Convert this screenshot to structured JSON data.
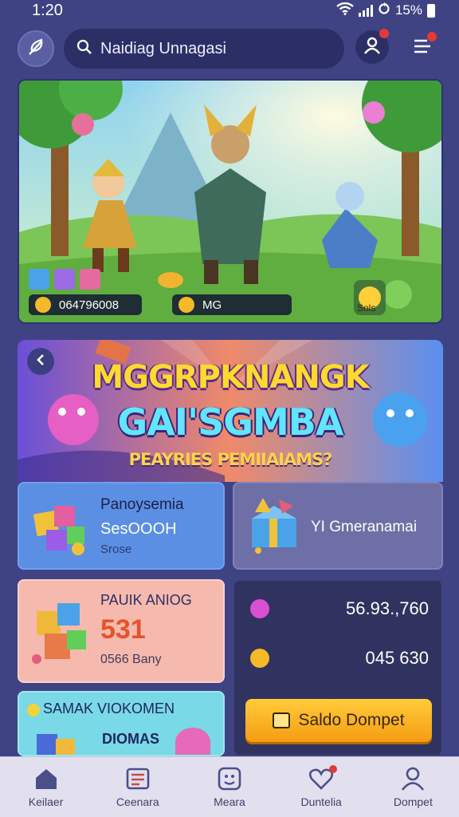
{
  "status_bar": {
    "time": "1:20",
    "battery": "15%"
  },
  "header": {
    "search_text": "Naidiag Unnagasi"
  },
  "hero": {
    "stat_left": "064796008",
    "stat_mid": "MG",
    "badge": "Sols"
  },
  "promo": {
    "title_line1": "MGGRPKNANGK",
    "title_line2": "GAI'SGMBA",
    "subtitle": "PEAYRIES PEMIIAIAMS?"
  },
  "cards": {
    "blue": {
      "title": "Panoysemia",
      "amount": "SesOOOH",
      "note": "Srose"
    },
    "lavender": {
      "label": "YI Gmeranamai"
    },
    "pink": {
      "title": "PAUIK ANIOG",
      "value": "531",
      "note": "0566 Bany"
    },
    "teal": {
      "title": "SAMAK VIOKOMEN",
      "sub": "DIOMAS"
    }
  },
  "balance": {
    "row1_value": "56.93.,760",
    "row2_value": "045 630",
    "wallet_button": "Saldo Dompet"
  },
  "nav": [
    {
      "label": "Keilaer",
      "icon": "home-icon"
    },
    {
      "label": "Ceenara",
      "icon": "list-card-icon"
    },
    {
      "label": "Meara",
      "icon": "smiley-icon"
    },
    {
      "label": "Duntelia",
      "icon": "heart-icon"
    },
    {
      "label": "Dompet",
      "icon": "person-icon"
    }
  ],
  "colors": {
    "background": "#3f4384",
    "accent_yellow": "#f6b928",
    "nav_bg": "#e2e0ef"
  }
}
